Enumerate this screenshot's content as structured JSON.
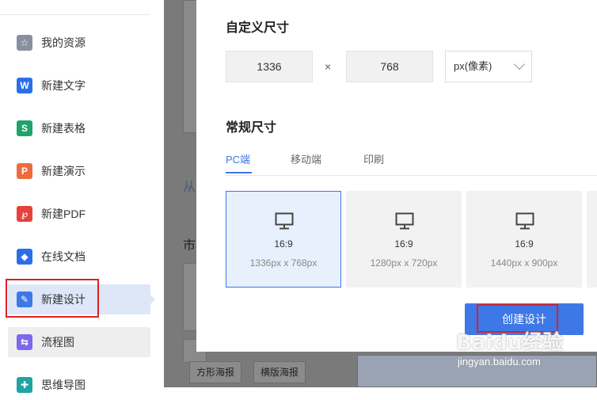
{
  "sidebar": {
    "items": [
      {
        "label": "我的资源",
        "icon": "star-icon",
        "color": "#8a8fa0",
        "glyph": "☆"
      },
      {
        "label": "新建文字",
        "icon": "writer-icon",
        "color": "#2b6fe8",
        "glyph": "W"
      },
      {
        "label": "新建表格",
        "icon": "spreadsheet-icon",
        "color": "#1fa36b",
        "glyph": "S"
      },
      {
        "label": "新建演示",
        "icon": "presentation-icon",
        "color": "#ef6b3a",
        "glyph": "P"
      },
      {
        "label": "新建PDF",
        "icon": "pdf-icon",
        "color": "#e6413a",
        "glyph": "℘"
      },
      {
        "label": "在线文档",
        "icon": "online-doc-icon",
        "color": "#2b6fe8",
        "glyph": "◆"
      },
      {
        "label": "新建设计",
        "icon": "design-icon",
        "color": "#3d78e6",
        "glyph": "✎"
      },
      {
        "label": "流程图",
        "icon": "flowchart-icon",
        "color": "#7b68ee",
        "glyph": "⇆"
      },
      {
        "label": "思维导图",
        "icon": "mindmap-icon",
        "color": "#1fa3a3",
        "glyph": "✚"
      }
    ],
    "active_index": 6
  },
  "background": {
    "link_fragment": "从",
    "section_fragment": "市",
    "tags": [
      "方形海报",
      "横版海报"
    ]
  },
  "modal": {
    "custom_title": "自定义尺寸",
    "width_value": "1336",
    "times_sign": "×",
    "height_value": "768",
    "unit_selected": "px(像素)",
    "common_title": "常规尺寸",
    "tabs": [
      "PC端",
      "移动端",
      "印刷"
    ],
    "active_tab": 0,
    "presets": [
      {
        "ratio": "16:9",
        "dims": "1336px x 768px",
        "selected": true
      },
      {
        "ratio": "16:9",
        "dims": "1280px x 720px",
        "selected": false
      },
      {
        "ratio": "16:9",
        "dims": "1440px x 900px",
        "selected": false
      }
    ],
    "create_label": "创建设计"
  },
  "watermark": {
    "brand": "Baidu经验",
    "url": "jingyan.baidu.com"
  },
  "colors": {
    "accent": "#3d78e6",
    "highlight": "#e02020"
  }
}
